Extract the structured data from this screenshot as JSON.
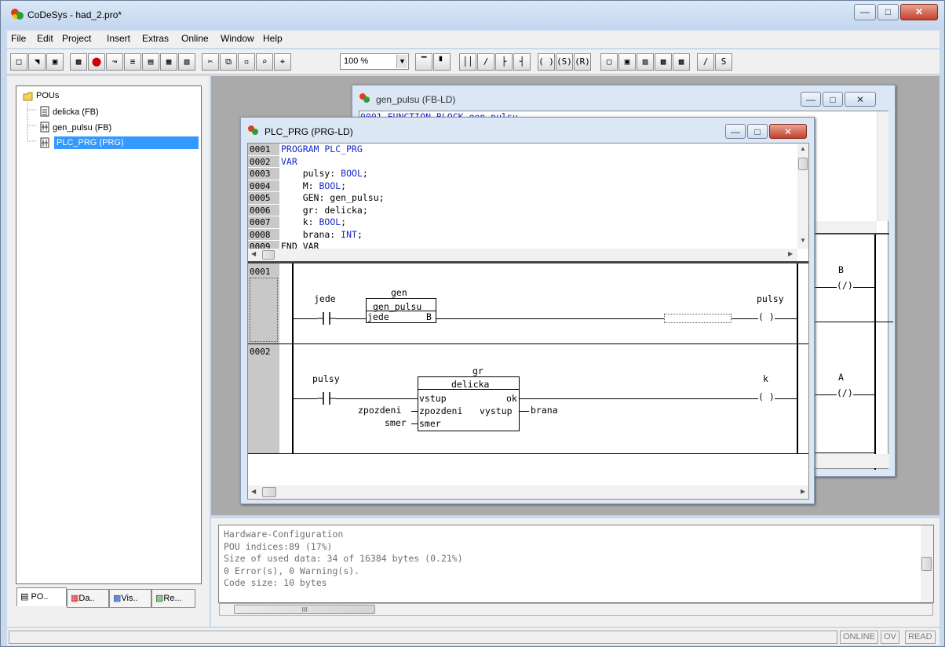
{
  "app": {
    "title": "CoDeSys - had_2.pro*"
  },
  "menu": [
    "File",
    "Edit",
    "Project",
    "Insert",
    "Extras",
    "Online",
    "Window",
    "Help"
  ],
  "toolbar": {
    "zoom": "100 %"
  },
  "tree": {
    "root": "POUs",
    "items": [
      "delicka (FB)",
      "gen_pulsu (FB)",
      "PLC_PRG (PRG)"
    ]
  },
  "bottom_tabs": [
    "PO..",
    "Da..",
    "Vis..",
    "Re..."
  ],
  "back_window": {
    "title": "gen_pulsu (FB-LD)",
    "first_line": "0001 FUNCTION_BLOCK gen_pulsu",
    "rungs": [
      {
        "label": "B",
        "coil": "(/)"
      },
      {
        "label": "A",
        "coil": "(/)"
      }
    ]
  },
  "front_window": {
    "title": "PLC_PRG (PRG-LD)",
    "code": [
      {
        "ln": "0001",
        "text": "PROGRAM PLC_PRG",
        "kw": "PROGRAM"
      },
      {
        "ln": "0002",
        "text": "VAR",
        "kw": "VAR"
      },
      {
        "ln": "0003",
        "text": "    pulsy: BOOL;"
      },
      {
        "ln": "0004",
        "text": "    M: BOOL;"
      },
      {
        "ln": "0005",
        "text": "    GEN: gen_pulsu;"
      },
      {
        "ln": "0006",
        "text": "    gr: delicka;"
      },
      {
        "ln": "0007",
        "text": "    k: BOOL;"
      },
      {
        "ln": "0008",
        "text": "    brana: INT;"
      },
      {
        "ln": "0009",
        "text": "END_VAR"
      }
    ],
    "rung1": {
      "num": "0001",
      "contact": "jede",
      "fb_instance": "gen",
      "fb_type": "gen_pulsu",
      "fb_in": "jede",
      "fb_out": "B",
      "coil_var": "pulsy",
      "coil": "( )"
    },
    "rung2": {
      "num": "0002",
      "contact": "pulsy",
      "fb_instance": "gr",
      "fb_type": "delicka",
      "in1": "vstup",
      "in2": "zpozdeni",
      "in3": "smer",
      "out1": "ok",
      "out2": "vystup",
      "var_in2": "zpozdeni",
      "var_in3": "smer",
      "var_out2": "brana",
      "coil_var": "k",
      "coil": "( )"
    }
  },
  "messages": [
    "Hardware-Configuration",
    "POU indices:89 (17%)",
    "Size of used data: 34 of 16384 bytes (0.21%)",
    "0 Error(s), 0 Warning(s).",
    "Code size: 10 bytes"
  ],
  "status": [
    "ONLINE",
    "OV",
    "READ"
  ],
  "scroll_mark": "III"
}
